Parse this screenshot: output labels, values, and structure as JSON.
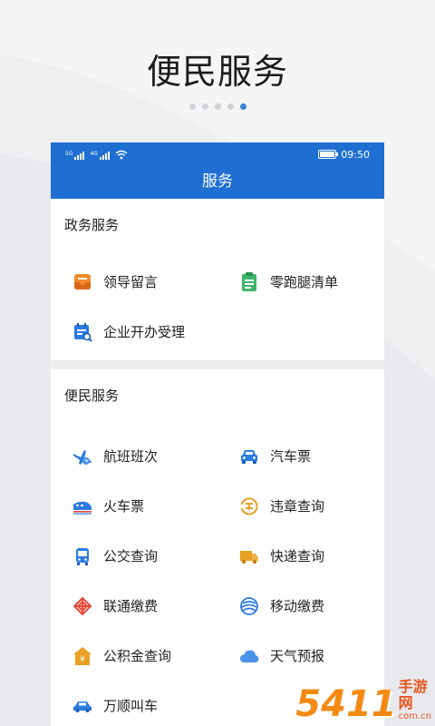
{
  "hero": {
    "title": "便民服务",
    "page_count": 5,
    "active_page": 5
  },
  "statusbar": {
    "network1": "5G",
    "network2": "4G",
    "time": "09:50"
  },
  "appbar": {
    "title": "服务"
  },
  "colors": {
    "primary": "#1e6fd1",
    "accent_dot": "#3b7fd6",
    "orange": "#f08a2c",
    "green": "#3db56a",
    "blue": "#2b7be0"
  },
  "sections": {
    "gov": {
      "title": "政务服务",
      "items": [
        {
          "label": "领导留言",
          "icon": "message-box-icon"
        },
        {
          "label": "零跑腿清单",
          "icon": "checklist-icon"
        },
        {
          "label": "企业开办受理",
          "icon": "calendar-search-icon"
        }
      ]
    },
    "life": {
      "title": "便民服务",
      "items": [
        {
          "label": "航班班次",
          "icon": "airplane-icon"
        },
        {
          "label": "汽车票",
          "icon": "car-icon"
        },
        {
          "label": "火车票",
          "icon": "train-icon"
        },
        {
          "label": "违章查询",
          "icon": "violation-icon"
        },
        {
          "label": "公交查询",
          "icon": "bus-icon"
        },
        {
          "label": "快递查询",
          "icon": "truck-icon"
        },
        {
          "label": "联通缴费",
          "icon": "unicom-icon"
        },
        {
          "label": "移动缴费",
          "icon": "mobile-icon"
        },
        {
          "label": "公积金查询",
          "icon": "house-fund-icon"
        },
        {
          "label": "天气预报",
          "icon": "cloud-icon"
        },
        {
          "label": "万顺叫车",
          "icon": "taxi-icon"
        }
      ]
    }
  },
  "watermark": {
    "number": "5411",
    "cn": "手游网",
    "url": "com.cn"
  }
}
